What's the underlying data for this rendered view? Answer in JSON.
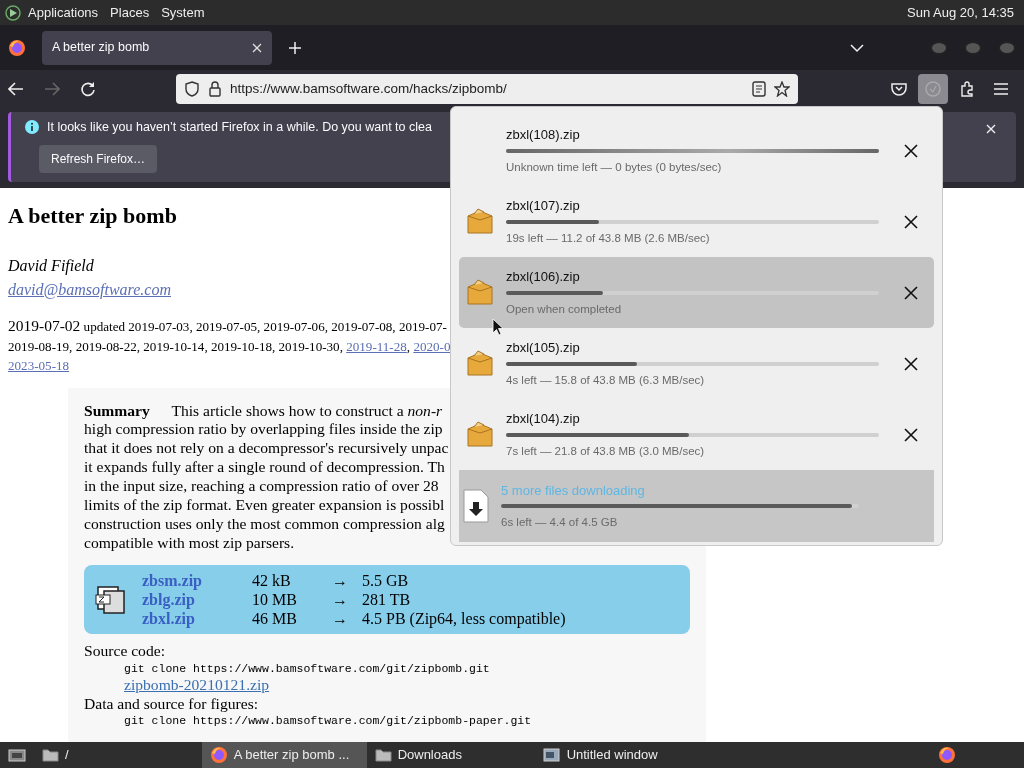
{
  "top_bar": {
    "menus": [
      "Applications",
      "Places",
      "System"
    ],
    "clock": "Sun Aug 20, 14:35"
  },
  "tabs": [
    {
      "title": "A better zip bomb",
      "selected": true
    }
  ],
  "nav": {
    "url": "https://www.bamsoftware.com/hacks/zipbomb/",
    "forward_disabled": true,
    "downloads_open": true
  },
  "notification": {
    "message": "It looks like you haven’t started Firefox in a while. Do you want to clea",
    "button": "Refresh Firefox…"
  },
  "page": {
    "title": "A better zip bomb",
    "author": "David Fifield",
    "email": "david@bamsoftware.com",
    "date_lines": [
      [
        {
          "kind": "main",
          "text": "2019-07-02"
        },
        {
          "kind": "plain",
          "text": " updated 2019-07-03, 2019-07-05, 2019-07-06, 2019-07-08, 2019-07-"
        }
      ],
      [
        {
          "kind": "plain",
          "text": "2019-08-19, 2019-08-22, 2019-10-14, 2019-10-18, 2019-10-30, "
        },
        {
          "kind": "link",
          "text": "2019-11-28"
        },
        {
          "kind": "plain",
          "text": ", "
        },
        {
          "kind": "link",
          "text": "2020-0"
        }
      ],
      [
        {
          "kind": "link",
          "text": "2023-05-18"
        }
      ]
    ],
    "summary_lines": [
      "**Summary** This article shows how to construct a *non-r*",
      "high compression ratio by overlapping files inside the zip",
      "that it does not rely on a decompressor's recursively unpac",
      "it expands fully after a single round of decompression. Th",
      "in the input size, reaching a compression ratio of over 28",
      "limits of the zip format. Even greater expansion is possibl",
      "construction uses only the most common compression alg",
      "compatible with most zip parsers."
    ],
    "files": [
      {
        "name": "zbsm.zip",
        "size": "42 kB",
        "arrow": "→",
        "result": "5.5 GB"
      },
      {
        "name": "zblg.zip",
        "size": "10 MB",
        "arrow": "→",
        "result": "281 TB"
      },
      {
        "name": "zbxl.zip",
        "size": "46 MB",
        "arrow": "→",
        "result": "4.5 PB (Zip64, less compatible)"
      }
    ],
    "source": {
      "label": "Source code:",
      "command": "git clone https://www.bamsoftware.com/git/zipbomb.git",
      "archive": "zipbomb-20210121.zip",
      "figures_label": "Data and source for figures:",
      "figures_command": "git clone https://www.bamsoftware.com/git/zipbomb-paper.git"
    }
  },
  "downloads": {
    "items": [
      {
        "name": "zbxl(108).zip",
        "icon": false,
        "kind": "indeterminate",
        "status": "Unknown time left — 0 bytes (0 bytes/sec)",
        "selected": false
      },
      {
        "name": "zbxl(107).zip",
        "icon": true,
        "kind": "progress",
        "level": 0.25,
        "status": "19s left — 11.2 of 43.8 MB (2.6 MB/sec)",
        "selected": false
      },
      {
        "name": "zbxl(106).zip",
        "icon": true,
        "kind": "progress",
        "level": 0.26,
        "status": "Open when completed",
        "selected": true
      },
      {
        "name": "zbxl(105).zip",
        "icon": true,
        "kind": "progress",
        "level": 0.35,
        "status": "4s left — 15.8 of 43.8 MB (6.3 MB/sec)",
        "selected": false
      },
      {
        "name": "zbxl(104).zip",
        "icon": true,
        "kind": "progress",
        "level": 0.49,
        "status": "7s left — 21.8 of 43.8 MB (3.0 MB/sec)",
        "selected": false
      }
    ],
    "summary": {
      "title": "5 more files downloading",
      "level": 0.98,
      "status": "6s left — 4.4 of 4.5 GB"
    }
  },
  "taskbar": [
    {
      "label": "/",
      "kind": "folder",
      "selected": false
    },
    {
      "label": "A better zip bomb ...",
      "kind": "browser",
      "selected": true
    },
    {
      "label": "Downloads",
      "kind": "folder",
      "selected": false
    },
    {
      "label": "Untitled window",
      "kind": "app",
      "selected": false
    }
  ]
}
